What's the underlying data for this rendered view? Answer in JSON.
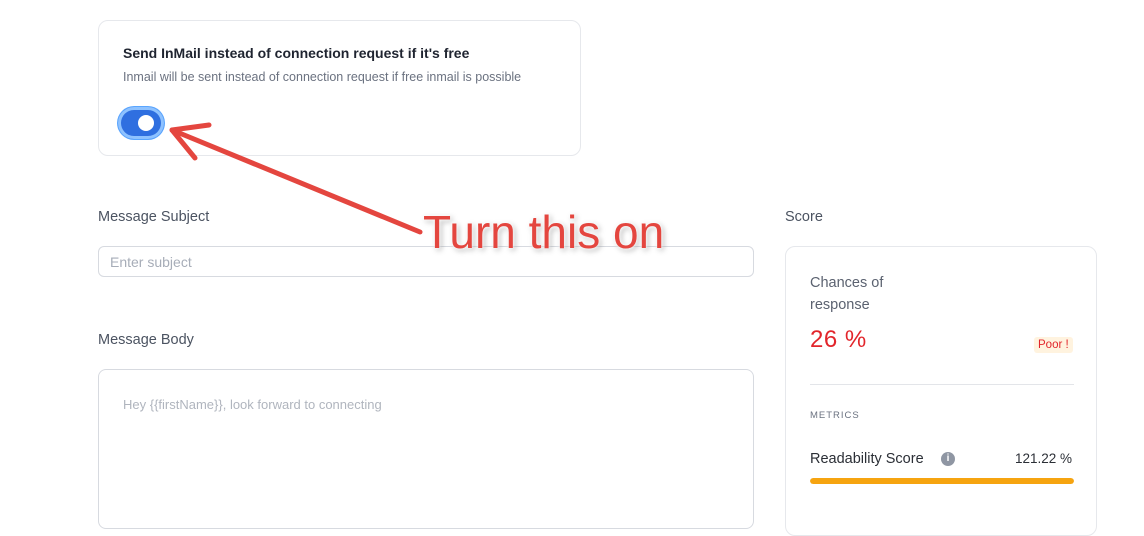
{
  "inmail": {
    "title": "Send InMail instead of connection request if it's free",
    "description": "Inmail will be sent instead of connection request if free inmail is possible",
    "toggle_on": true
  },
  "message": {
    "subject_label": "Message Subject",
    "subject_placeholder": "Enter subject",
    "body_label": "Message Body",
    "body_placeholder": "Hey {{firstName}}, look forward to connecting"
  },
  "score": {
    "label": "Score",
    "chances_label": "Chances of response",
    "percent": "26 %",
    "rating": "Poor !",
    "metrics_label": "METRICS",
    "readability_label": "Readability Score",
    "readability_value": "121.22 %",
    "readability_fill": 1.0
  },
  "annotation": {
    "text": "Turn this on"
  },
  "colors": {
    "accent": "#2f6fe0",
    "danger": "#e2252b",
    "annotation": "#e4463f",
    "bar": "#f6a410"
  }
}
